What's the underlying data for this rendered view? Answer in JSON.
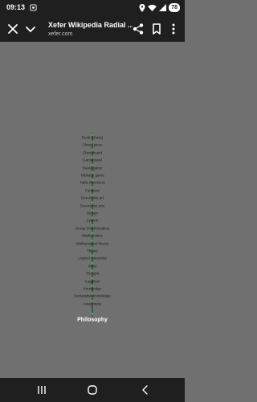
{
  "status_bar": {
    "time": "09:13",
    "battery": "78",
    "icons": [
      "screenshot-icon",
      "location-icon",
      "wifi-icon",
      "signal-icon",
      "battery-icon"
    ]
  },
  "toolbar": {
    "title": "Xefer Wikipedia Radial ...",
    "url": "xefer.com",
    "icons": [
      "close-icon",
      "chevron-down-icon",
      "share-icon",
      "bookmark-icon",
      "more-vert-icon"
    ]
  },
  "graph": {
    "nodes": [
      "Rook (chess)",
      "Chess piece",
      "Chessboard",
      "Gameboard",
      "Board game",
      "Tabletop game",
      "Table (furniture)",
      "Furniture",
      "Decorative art",
      "Decorative arts",
      "Design",
      "System",
      "Group (mathematics)",
      "Mathematics",
      "Mathematical theory",
      "Theory",
      "Logical reasoning",
      "Mind",
      "Thought",
      "Cognition",
      "Knowledge",
      "Declarative knowledge",
      "Awareness",
      "Philosophy"
    ],
    "node_color": "#2db82d",
    "line_color": "#1a1a1a",
    "background": "#707070"
  },
  "nav_bar": {
    "icons": [
      "recent-apps-icon",
      "home-icon",
      "back-icon"
    ]
  }
}
